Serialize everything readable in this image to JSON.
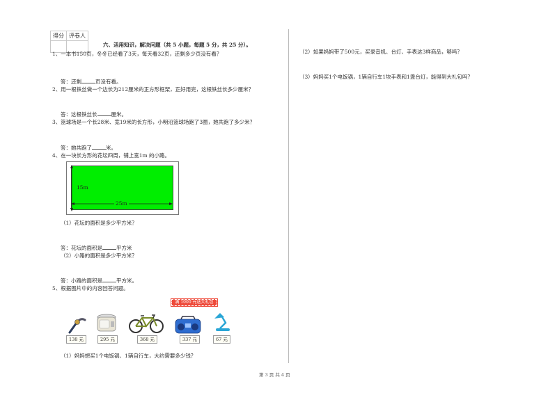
{
  "score_box": {
    "col1": "得分",
    "col2": "评卷人"
  },
  "section": {
    "title": "六、活用知识，解决问题（共 5 小题，每题 5 分，共 25 分）。"
  },
  "questions": {
    "q1": {
      "text": "1、一本书150页，冬冬已经看了3天，每天看32页，还剩多少页没有看？",
      "answer_prefix": "答：还剩",
      "answer_suffix": "页没有看。"
    },
    "q2": {
      "text": "2、用一根铁丝做一个边长为212厘米的正方形框架，正好用完，这根铁丝长多少厘米？",
      "answer_prefix": "答：这根铁丝长",
      "answer_suffix": "厘米。"
    },
    "q3": {
      "text": "3、篮球场是一个长28米、宽19米的长方形，小明沿篮球场跑了3圈，她共跑了多少米？",
      "answer_prefix": "答：她共跑了",
      "answer_suffix": "米。"
    },
    "q4": {
      "text": "4、在一块长方形的花坛四周，铺上宽1m 的小路。",
      "figure": {
        "width_label": "15m",
        "length_label": "25m",
        "fill_color": "#00ee00"
      },
      "sub1": "（1）花坛的面积是多少平方米？",
      "sub1_answer_prefix": "答：花坛的面积是",
      "sub1_answer_suffix": "平方米",
      "sub2": "（2）小路的面积是多少平方米？",
      "sub2_answer_prefix": "答：小路的面积是",
      "sub2_answer_suffix": "平方米。"
    },
    "q5": {
      "text": "5、根据图片中的内容回答问题。",
      "promo": "满 1000 元送大礼包",
      "items": [
        {
          "name": "watch",
          "price": "138 元"
        },
        {
          "name": "rice-cooker",
          "price": "295 元"
        },
        {
          "name": "bicycle",
          "price": "368 元"
        },
        {
          "name": "radio",
          "price": "337 元"
        },
        {
          "name": "desk-lamp",
          "price": "67 元"
        }
      ],
      "sub1": "（1）妈妈想买1个电饭锅、1辆自行车，大约需要多少钱？",
      "sub2": "（2）如果妈妈带了500元，买录音机、台灯、手表这3样商品，够吗？",
      "sub3": "（3）妈妈买1个电饭锅，1辆自行车1块手表和1盏台灯，能得到大礼包吗？"
    }
  },
  "footer": {
    "page": "第 3 页 共 4 页"
  }
}
